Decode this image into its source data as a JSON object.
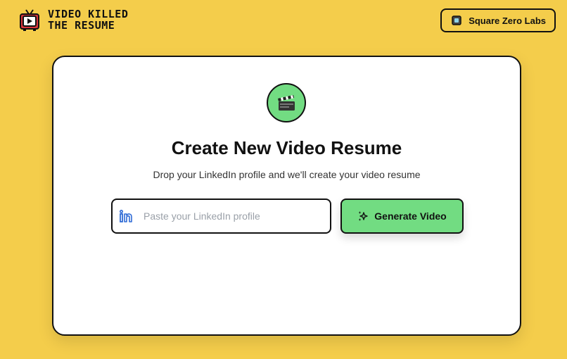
{
  "brand": {
    "title_line1": "VIDEO KILLED",
    "title_line2": "THE RESUME",
    "logo_icon": "retro-tv-play-icon"
  },
  "header": {
    "org_button_label": "Square Zero Labs",
    "org_icon": "cube-icon"
  },
  "card": {
    "badge_icon": "clapperboard-icon",
    "title": "Create New Video Resume",
    "subtitle": "Drop your LinkedIn profile and we'll create your video resume",
    "input": {
      "placeholder": "Paste your LinkedIn profile",
      "value": "",
      "icon": "linkedin-icon"
    },
    "generate_button": {
      "label": "Generate Video",
      "icon": "sparkles-icon"
    }
  },
  "colors": {
    "background": "#f4cd4b",
    "accent_green": "#72dc82",
    "logo_red": "#d9363e",
    "linkedin_blue": "#2f6bd6"
  }
}
